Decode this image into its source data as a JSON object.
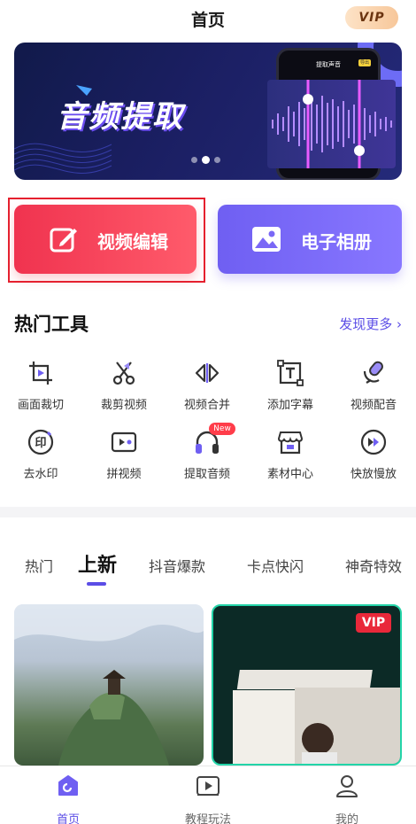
{
  "header": {
    "title": "首页",
    "vip_label": "VIP"
  },
  "banner": {
    "title": "音频提取",
    "phone_title": "提取声音",
    "phone_badge": "导出",
    "dots_count": 3,
    "active_dot": 2
  },
  "big_buttons": [
    {
      "label": "视频编辑",
      "icon": "edit-icon"
    },
    {
      "label": "电子相册",
      "icon": "image-icon"
    }
  ],
  "hot_tools": {
    "title": "热门工具",
    "more_label": "发现更多 ›",
    "items": [
      {
        "label": "画面裁切",
        "icon": "crop-icon"
      },
      {
        "label": "裁剪视频",
        "icon": "scissors-icon"
      },
      {
        "label": "视频合并",
        "icon": "merge-icon"
      },
      {
        "label": "添加字幕",
        "icon": "subtitle-icon"
      },
      {
        "label": "视频配音",
        "icon": "dubbing-icon"
      },
      {
        "label": "去水印",
        "icon": "watermark-icon"
      },
      {
        "label": "拼视频",
        "icon": "splice-icon"
      },
      {
        "label": "提取音频",
        "icon": "headphones-icon",
        "badge": "New"
      },
      {
        "label": "素材中心",
        "icon": "store-icon"
      },
      {
        "label": "快放慢放",
        "icon": "speed-icon"
      }
    ]
  },
  "tabs": [
    {
      "label": "热门",
      "active": false
    },
    {
      "label": "上新",
      "active": true
    },
    {
      "label": "抖音爆款",
      "active": false
    },
    {
      "label": "卡点快闪",
      "active": false
    },
    {
      "label": "神奇特效",
      "active": false
    }
  ],
  "cards": [
    {
      "vip": false
    },
    {
      "vip": true,
      "vip_label": "VIP"
    }
  ],
  "bottom_nav": [
    {
      "label": "首页",
      "icon": "home-icon",
      "active": true
    },
    {
      "label": "教程玩法",
      "icon": "tutorial-play-icon",
      "active": false
    },
    {
      "label": "我的",
      "icon": "profile-icon",
      "active": false
    }
  ],
  "colors": {
    "accent": "#5b4de6",
    "video_button": "#f0334f",
    "album_button": "#7a68f6",
    "new_badge": "#ff3d4a",
    "vip_tag": "#e9283a"
  }
}
